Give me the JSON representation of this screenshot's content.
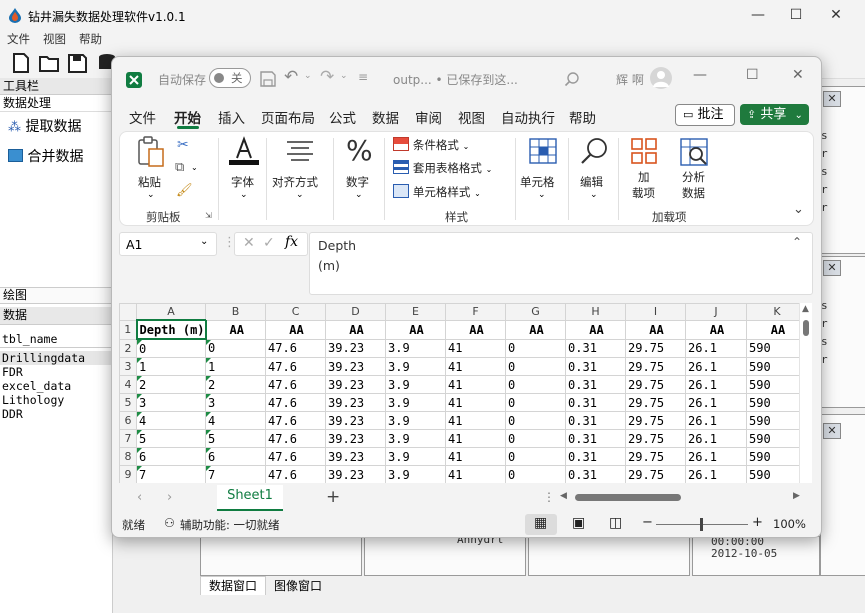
{
  "app": {
    "title": "钻井漏失数据处理软件v1.0.1",
    "menu": [
      "文件",
      "视图",
      "帮助"
    ],
    "toolbox_title": "工具栏",
    "data_process_label": "数据处理",
    "tools": [
      "提取数据",
      "合并数据"
    ],
    "draw_label": "绘图",
    "data_title": "数据",
    "tables": [
      "tbl_name",
      "Drillingdata",
      "FDR",
      "excel_data",
      "Lithology",
      "DDR"
    ],
    "bottom_tabs": [
      "数据窗口",
      "图像窗口"
    ],
    "bg_texts": {
      "anhydr": "Anhydrl",
      "time1": "00:00:00",
      "time2": "2012-10-05"
    }
  },
  "excel": {
    "autosave_label": "自动保存",
    "autosave_state": "关",
    "filename": "outp... • 已保存到这...",
    "user_name": "辉 啊",
    "tabs": [
      "文件",
      "开始",
      "插入",
      "页面布局",
      "公式",
      "数据",
      "审阅",
      "视图",
      "自动执行",
      "帮助"
    ],
    "active_tab": "开始",
    "comment_btn": "批注",
    "share_btn": "共享",
    "ribbon": {
      "paste": "粘贴",
      "clipboard_label": "剪贴板",
      "font": "字体",
      "align": "对齐方式",
      "number": "数字",
      "cond_format": "条件格式",
      "table_format": "套用表格格式",
      "cell_style": "单元格样式",
      "styles_label": "样式",
      "cells": "单元格",
      "edit": "编辑",
      "addins_1": "加",
      "addins_2": "载项",
      "analysis_1": "分析",
      "analysis_2": "数据",
      "addins_label": "加载项"
    },
    "namebox": "A1",
    "fx": "fx",
    "formula_line1": "Depth",
    "formula_line2": "(m)",
    "columns": [
      "A",
      "B",
      "C",
      "D",
      "E",
      "F",
      "G",
      "H",
      "I",
      "J",
      "K"
    ],
    "header_row": [
      "Depth (m)",
      "AA",
      "AA",
      "AA",
      "AA",
      "AA",
      "AA",
      "AA",
      "AA",
      "AA",
      "AA"
    ],
    "rows": [
      {
        "n": "2",
        "cells": [
          "0",
          "0",
          "47.6",
          "39.23",
          "3.9",
          "41",
          "0",
          "0.31",
          "29.75",
          "26.1",
          "590"
        ]
      },
      {
        "n": "3",
        "cells": [
          "1",
          "1",
          "47.6",
          "39.23",
          "3.9",
          "41",
          "0",
          "0.31",
          "29.75",
          "26.1",
          "590"
        ]
      },
      {
        "n": "4",
        "cells": [
          "2",
          "2",
          "47.6",
          "39.23",
          "3.9",
          "41",
          "0",
          "0.31",
          "29.75",
          "26.1",
          "590"
        ]
      },
      {
        "n": "5",
        "cells": [
          "3",
          "3",
          "47.6",
          "39.23",
          "3.9",
          "41",
          "0",
          "0.31",
          "29.75",
          "26.1",
          "590"
        ]
      },
      {
        "n": "6",
        "cells": [
          "4",
          "4",
          "47.6",
          "39.23",
          "3.9",
          "41",
          "0",
          "0.31",
          "29.75",
          "26.1",
          "590"
        ]
      },
      {
        "n": "7",
        "cells": [
          "5",
          "5",
          "47.6",
          "39.23",
          "3.9",
          "41",
          "0",
          "0.31",
          "29.75",
          "26.1",
          "590"
        ]
      },
      {
        "n": "8",
        "cells": [
          "6",
          "6",
          "47.6",
          "39.23",
          "3.9",
          "41",
          "0",
          "0.31",
          "29.75",
          "26.1",
          "590"
        ]
      },
      {
        "n": "9",
        "cells": [
          "7",
          "7",
          "47.6",
          "39.23",
          "3.9",
          "41",
          "0",
          "0.31",
          "29.75",
          "26.1",
          "590"
        ]
      }
    ],
    "sheet_tab": "Sheet1",
    "status": {
      "ready": "就绪",
      "accessibility": "辅助功能: 一切就绪",
      "zoom": "100%"
    },
    "colors": {
      "accent": "#107c41",
      "share": "#1f7a3d"
    }
  }
}
